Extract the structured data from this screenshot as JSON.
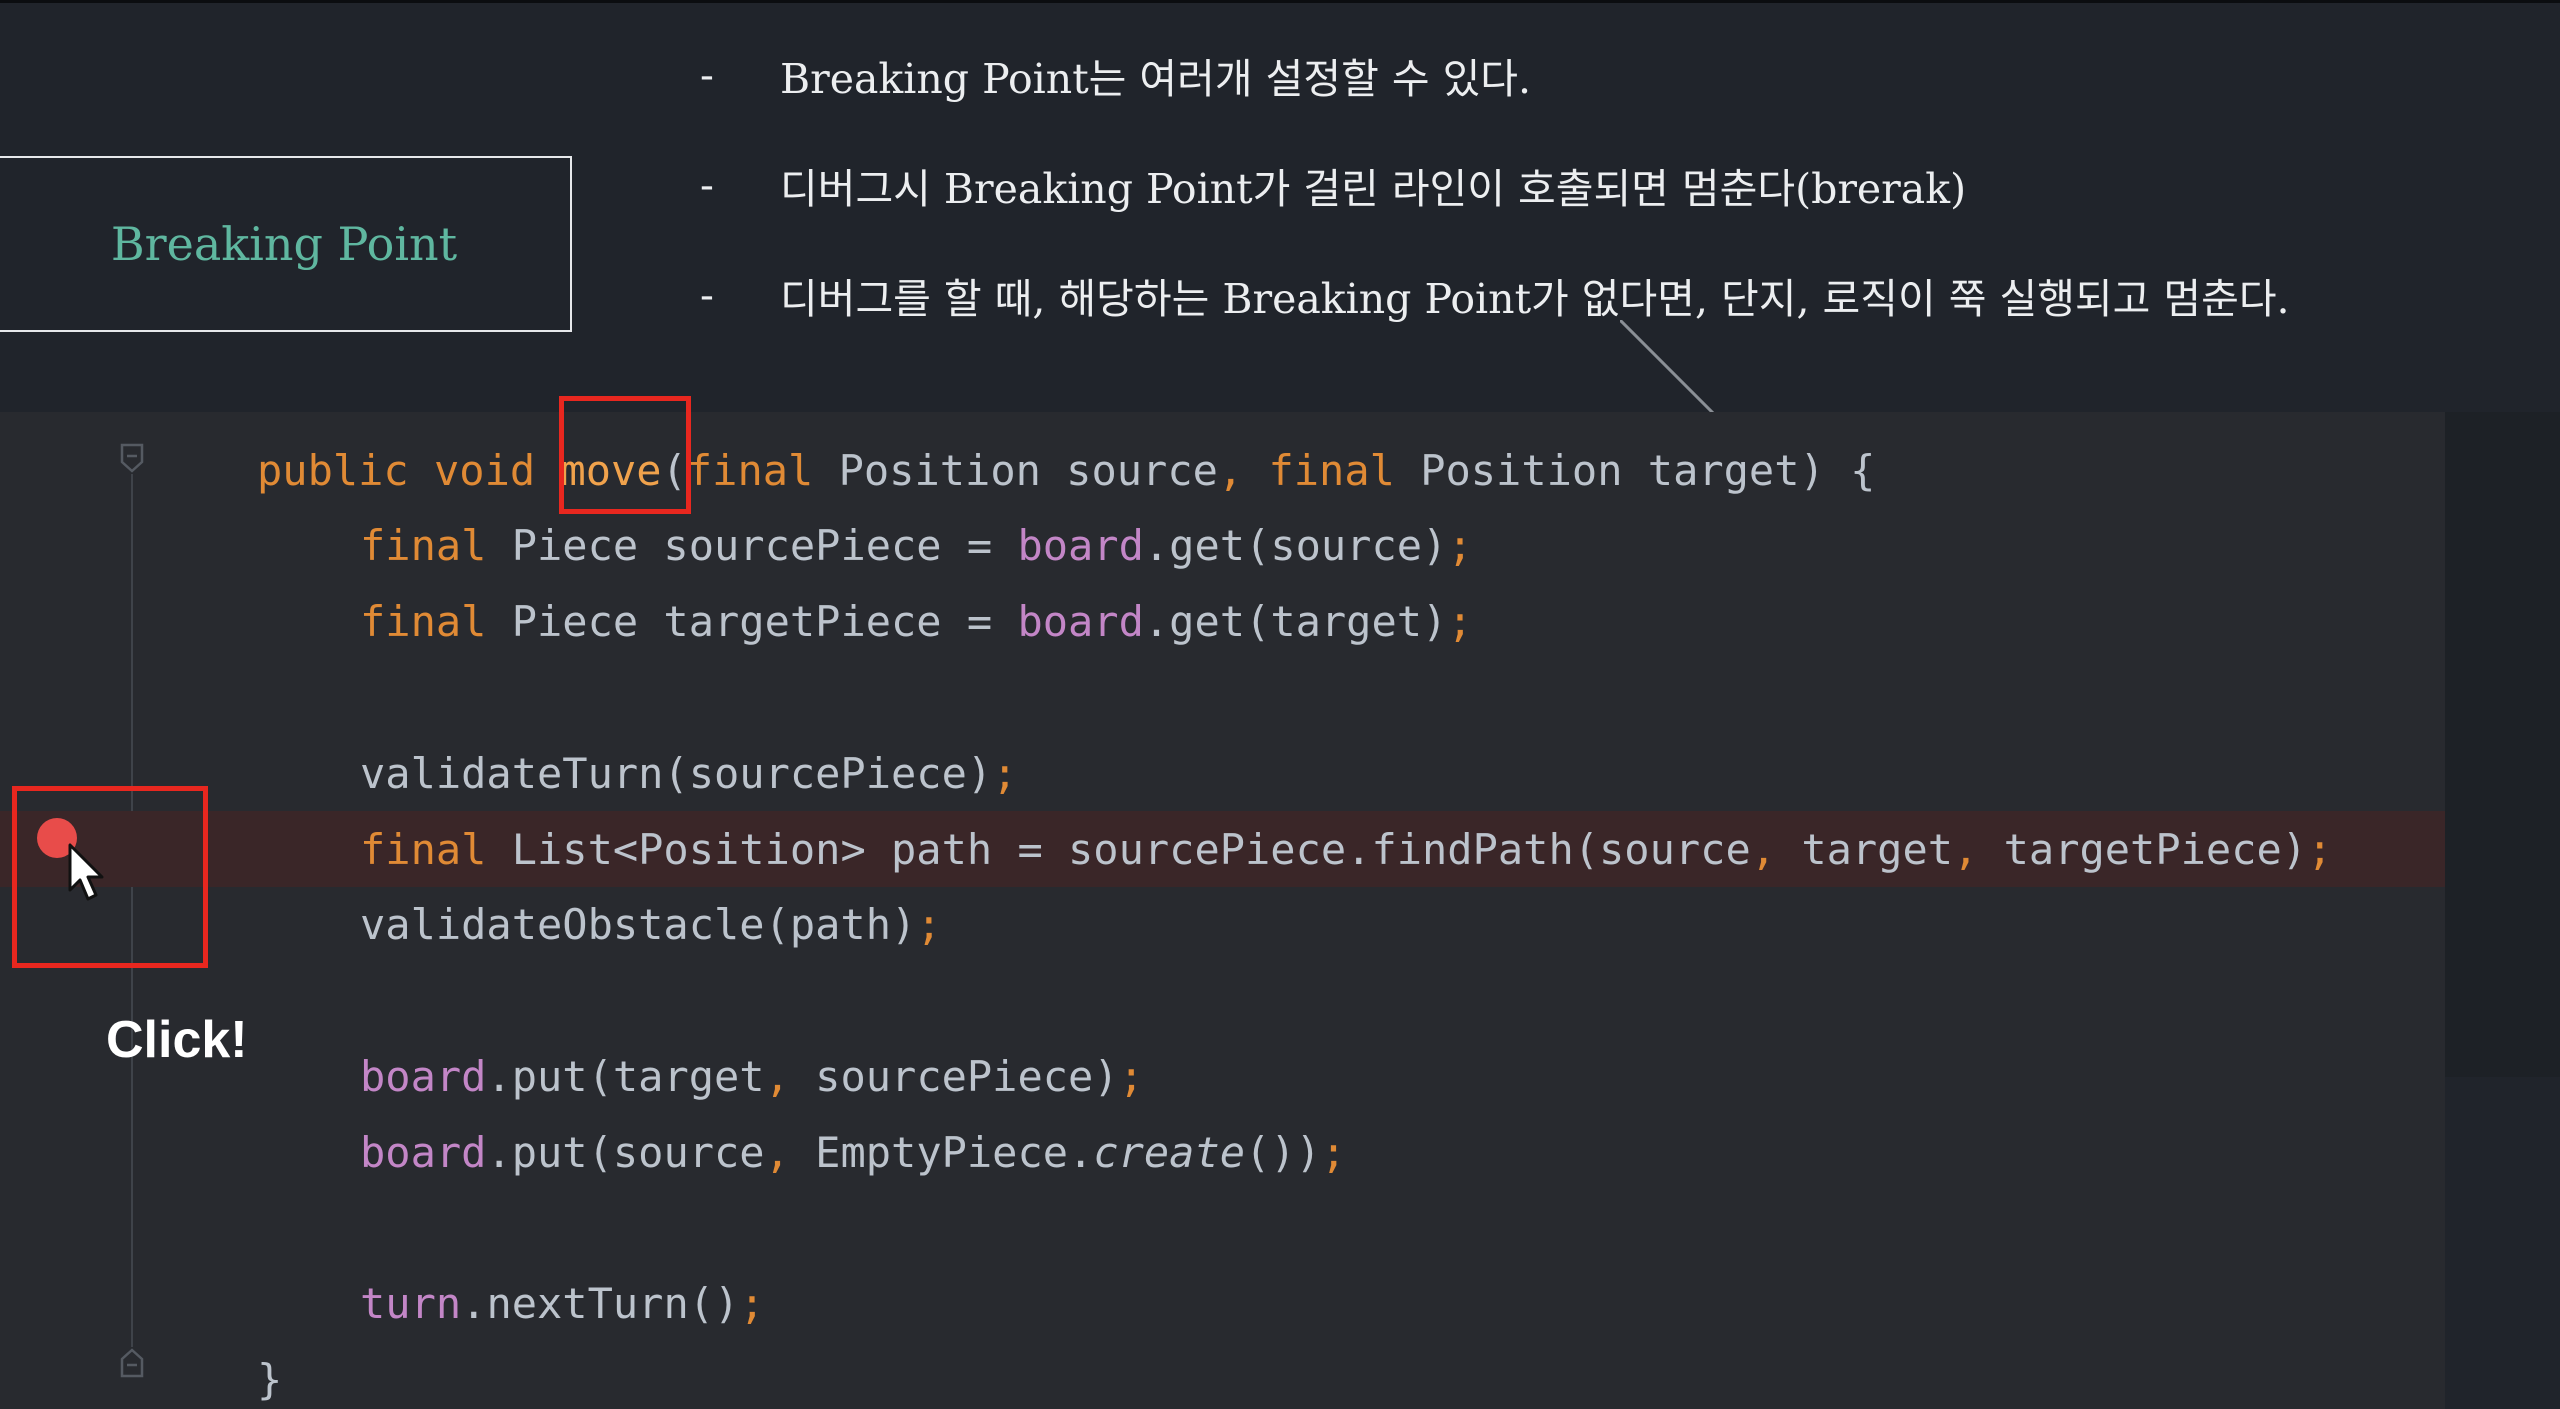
{
  "slide": {
    "title": "Breaking Point",
    "bullets": [
      {
        "dash": "-",
        "text": "Breaking Point는 여러개 설정할 수 있다."
      },
      {
        "dash": "-",
        "text": "디버그시 Breaking Point가 걸린 라인이 호출되면 멈춘다(brerak)"
      },
      {
        "dash": "-",
        "text": "디버그를 할 때, 해당하는 Breaking Point가 없다면,  단지, 로직이 쭉 실행되고 멈춘다."
      }
    ],
    "click_label": "Click!"
  },
  "editor": {
    "lines": [
      {
        "indent": 0,
        "tokens": [
          {
            "t": "public void ",
            "c": "kw"
          },
          {
            "t": "move",
            "c": "fn"
          },
          {
            "t": "(",
            "c": "plain"
          },
          {
            "t": "final ",
            "c": "kw"
          },
          {
            "t": "Position source",
            "c": "plain"
          },
          {
            "t": ", ",
            "c": "punct"
          },
          {
            "t": "final ",
            "c": "kw"
          },
          {
            "t": "Position target) {",
            "c": "plain"
          }
        ]
      },
      {
        "indent": 1,
        "tokens": [
          {
            "t": "final ",
            "c": "kw"
          },
          {
            "t": "Piece sourcePiece = ",
            "c": "plain"
          },
          {
            "t": "board",
            "c": "fld"
          },
          {
            "t": ".get(source)",
            "c": "plain"
          },
          {
            "t": ";",
            "c": "punct"
          }
        ]
      },
      {
        "indent": 1,
        "tokens": [
          {
            "t": "final ",
            "c": "kw"
          },
          {
            "t": "Piece targetPiece = ",
            "c": "plain"
          },
          {
            "t": "board",
            "c": "fld"
          },
          {
            "t": ".get(target)",
            "c": "plain"
          },
          {
            "t": ";",
            "c": "punct"
          }
        ]
      },
      {
        "indent": 1,
        "tokens": []
      },
      {
        "indent": 1,
        "tokens": [
          {
            "t": "validateTurn(sourcePiece)",
            "c": "plain"
          },
          {
            "t": ";",
            "c": "punct"
          }
        ]
      },
      {
        "indent": 1,
        "breakpoint": true,
        "tokens": [
          {
            "t": "final ",
            "c": "kw"
          },
          {
            "t": "List<Position> path = sourcePiece.findPath(source",
            "c": "plain"
          },
          {
            "t": ", ",
            "c": "punct"
          },
          {
            "t": "target",
            "c": "plain"
          },
          {
            "t": ", ",
            "c": "punct"
          },
          {
            "t": "targetPiece)",
            "c": "plain"
          },
          {
            "t": ";",
            "c": "punct"
          }
        ]
      },
      {
        "indent": 1,
        "tokens": [
          {
            "t": "validateObstacle(path)",
            "c": "plain"
          },
          {
            "t": ";",
            "c": "punct"
          }
        ]
      },
      {
        "indent": 1,
        "tokens": []
      },
      {
        "indent": 1,
        "tokens": [
          {
            "t": "board",
            "c": "fld"
          },
          {
            "t": ".put(target",
            "c": "plain"
          },
          {
            "t": ", ",
            "c": "punct"
          },
          {
            "t": "sourcePiece)",
            "c": "plain"
          },
          {
            "t": ";",
            "c": "punct"
          }
        ]
      },
      {
        "indent": 1,
        "tokens": [
          {
            "t": "board",
            "c": "fld"
          },
          {
            "t": ".put(source",
            "c": "plain"
          },
          {
            "t": ", ",
            "c": "punct"
          },
          {
            "t": "EmptyPiece.",
            "c": "plain"
          },
          {
            "t": "create",
            "c": "plain italic"
          },
          {
            "t": "())",
            "c": "plain"
          },
          {
            "t": ";",
            "c": "punct"
          }
        ]
      },
      {
        "indent": 1,
        "tokens": []
      },
      {
        "indent": 1,
        "tokens": [
          {
            "t": "turn",
            "c": "fld"
          },
          {
            "t": ".nextTurn()",
            "c": "plain"
          },
          {
            "t": ";",
            "c": "punct"
          }
        ]
      },
      {
        "indent": 0,
        "tokens": [
          {
            "t": "}",
            "c": "plain"
          }
        ]
      }
    ]
  },
  "colors": {
    "background": "#20242b",
    "title_text": "#5fb7a0",
    "keyword": "#e08a35",
    "field": "#c386c7",
    "highlight_box": "#e8271f",
    "breakpoint": "#e84c4a",
    "breakpoint_line": "#3a2628"
  },
  "icons": {
    "breakpoint": "breakpoint-dot-icon",
    "cursor": "mouse-pointer-icon",
    "fold": "fold-marker-icon",
    "arrow": "annotation-arrow-icon"
  }
}
